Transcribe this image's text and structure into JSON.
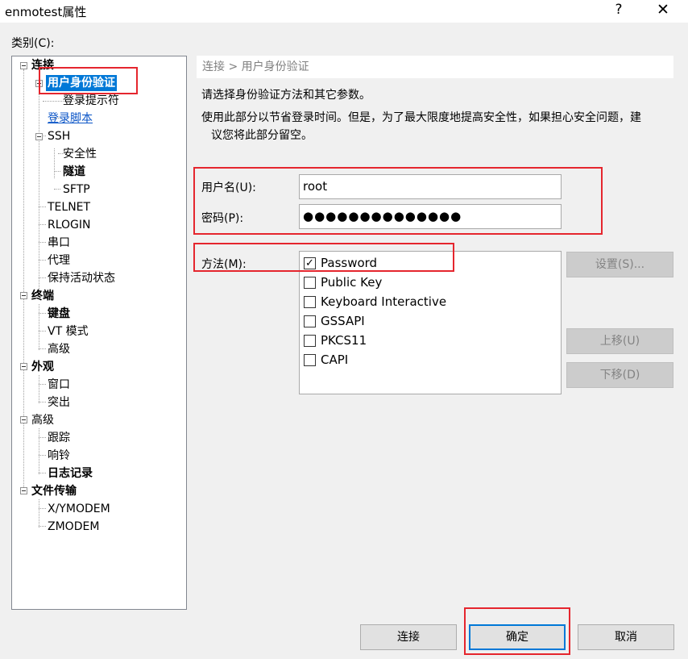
{
  "window": {
    "title": "enmotest属性",
    "help": "?",
    "close": "✕"
  },
  "category_label": "类别(C):",
  "tree": {
    "connection": "连接",
    "user_auth": "用户身份验证",
    "login_prompt": "登录提示符",
    "login_script": "登录脚本",
    "ssh": "SSH",
    "security": "安全性",
    "tunnel": "隧道",
    "sftp": "SFTP",
    "telnet": "TELNET",
    "rlogin": "RLOGIN",
    "serial": "串口",
    "proxy": "代理",
    "keepalive": "保持活动状态",
    "terminal": "终端",
    "keyboard": "键盘",
    "vt_mode": "VT 模式",
    "advanced_term": "高级",
    "appearance": "外观",
    "window": "窗口",
    "highlight": "突出",
    "advanced": "高级",
    "trace": "跟踪",
    "bell": "响铃",
    "logging": "日志记录",
    "file_transfer": "文件传输",
    "xymodem": "X/YMODEM",
    "zmodem": "ZMODEM"
  },
  "breadcrumb": "连接 > 用户身份验证",
  "desc1": "请选择身份验证方法和其它参数。",
  "desc2a": "使用此部分以节省登录时间。但是，为了最大限度地提高安全性，如果担心安全问题，建",
  "desc2b": "议您将此部分留空。",
  "username": {
    "label": "用户名(U):",
    "value": "root"
  },
  "password": {
    "label": "密码(P):",
    "value": "●●●●●●●●●●●●●●"
  },
  "method": {
    "label": "方法(M):",
    "items": [
      {
        "label": "Password",
        "checked": "✓"
      },
      {
        "label": "Public Key",
        "checked": ""
      },
      {
        "label": "Keyboard Interactive",
        "checked": ""
      },
      {
        "label": "GSSAPI",
        "checked": ""
      },
      {
        "label": "PKCS11",
        "checked": ""
      },
      {
        "label": "CAPI",
        "checked": ""
      }
    ]
  },
  "buttons": {
    "settings": "设置(S)...",
    "move_up": "上移(U)",
    "move_down": "下移(D)",
    "connect": "连接",
    "ok": "确定",
    "cancel": "取消"
  }
}
